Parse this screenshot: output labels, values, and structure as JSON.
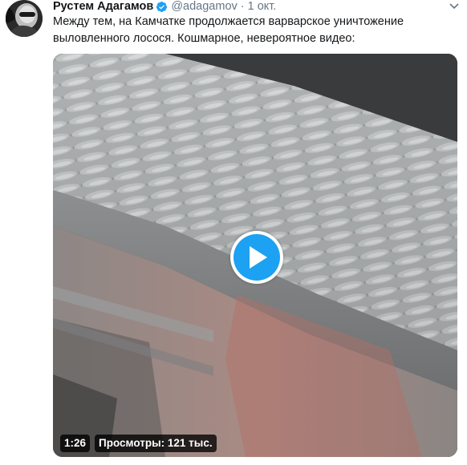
{
  "tweet": {
    "author_name": "Рустем Адагамов",
    "handle": "@adagamov",
    "separator": "·",
    "date": "1 окт.",
    "text": "Между тем, на Камчатке продолжается варварское уничтожение выловленного лосося. Кошмарное, невероятное видео:"
  },
  "video": {
    "duration": "1:26",
    "views": "Просмотры: 121 тыс."
  },
  "icons": {
    "verified": "verified-badge-icon",
    "caret": "chevron-down-icon",
    "play": "play-icon"
  },
  "colors": {
    "accent": "#1da1f2",
    "name": "#14171a",
    "meta": "#657786"
  }
}
